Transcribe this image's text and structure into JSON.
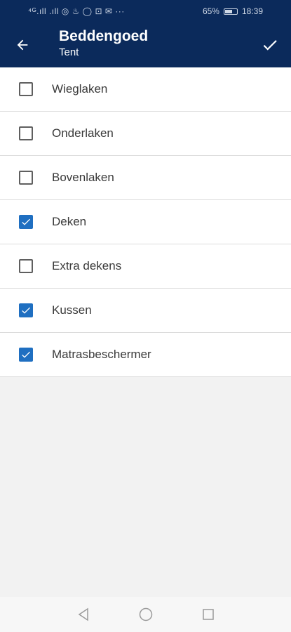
{
  "status_bar": {
    "left_text": "⁴ᴳ.ıll  .ıll ◎ ♨ ◯ ⊡ ✉ ···",
    "battery": "65%",
    "time": "18:39",
    "battery_level": 0.65
  },
  "app_bar": {
    "title": "Beddengoed",
    "subtitle": "Tent",
    "back_icon": "arrow-left-icon",
    "confirm_icon": "check-icon"
  },
  "items": [
    {
      "label": "Wieglaken",
      "checked": false
    },
    {
      "label": "Onderlaken",
      "checked": false
    },
    {
      "label": "Bovenlaken",
      "checked": false
    },
    {
      "label": "Deken",
      "checked": true
    },
    {
      "label": "Extra dekens",
      "checked": false
    },
    {
      "label": "Kussen",
      "checked": true
    },
    {
      "label": "Matrasbeschermer",
      "checked": true
    }
  ],
  "colors": {
    "app_bar": "#0b2a5b",
    "checkbox_checked": "#1f6fc1"
  },
  "nav_bar": {
    "back": "triangle-back-icon",
    "home": "circle-home-icon",
    "recents": "square-recents-icon"
  }
}
